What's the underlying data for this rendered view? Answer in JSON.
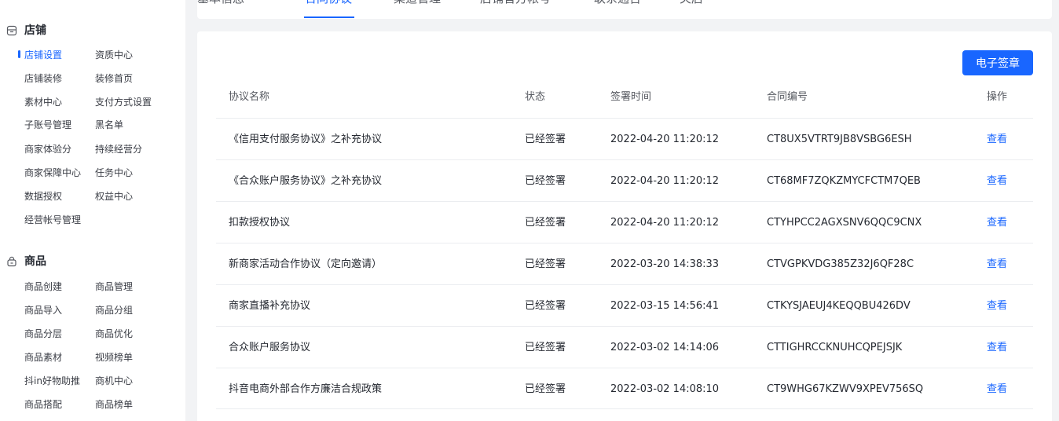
{
  "sidebar": {
    "sections": [
      {
        "title": "店铺",
        "icon": "store-icon",
        "items": [
          "店铺设置",
          "资质中心",
          "店铺装修",
          "装修首页",
          "素材中心",
          "支付方式设置",
          "子账号管理",
          "黑名单",
          "商家体验分",
          "持续经营分",
          "商家保障中心",
          "任务中心",
          "数据授权",
          "权益中心",
          "经营帐号管理"
        ],
        "active": "店铺设置"
      },
      {
        "title": "商品",
        "icon": "bag-icon",
        "items": [
          "商品创建",
          "商品管理",
          "商品导入",
          "商品分组",
          "商品分层",
          "商品优化",
          "商品素材",
          "视频榜单",
          "抖in好物助推",
          "商机中心",
          "商品搭配",
          "商品榜单"
        ]
      }
    ]
  },
  "tabs": {
    "items": [
      "基本信息",
      "合同协议",
      "渠道管理",
      "店铺官方帐号",
      "联系通告",
      "关店"
    ],
    "active": "合同协议"
  },
  "main": {
    "esign_button": "电子签章",
    "table": {
      "headers": [
        "协议名称",
        "状态",
        "签署时间",
        "合同编号",
        "操作"
      ],
      "rows": [
        {
          "name": "《信用支付服务协议》之补充协议",
          "status": "已经签署",
          "time": "2022-04-20 11:20:12",
          "no": "CT8UX5VTRT9JB8VSBG6ESH",
          "op": "查看"
        },
        {
          "name": "《合众账户服务协议》之补充协议",
          "status": "已经签署",
          "time": "2022-04-20 11:20:12",
          "no": "CT68MF7ZQKZMYCFCTM7QEB",
          "op": "查看"
        },
        {
          "name": "扣款授权协议",
          "status": "已经签署",
          "time": "2022-04-20 11:20:12",
          "no": "CTYHPCC2AGXSNV6QQC9CNX",
          "op": "查看"
        },
        {
          "name": "新商家活动合作协议（定向邀请）",
          "status": "已经签署",
          "time": "2022-03-20 14:38:33",
          "no": "CTVGPKVDG385Z32J6QF28C",
          "op": "查看"
        },
        {
          "name": "商家直播补充协议",
          "status": "已经签署",
          "time": "2022-03-15 14:56:41",
          "no": "CTKYSJAEUJ4KEQQBU426DV",
          "op": "查看"
        },
        {
          "name": "合众账户服务协议",
          "status": "已经签署",
          "time": "2022-03-02 14:14:06",
          "no": "CTTIGHRCCKNUHCQPEJSJK",
          "op": "查看"
        },
        {
          "name": "抖音电商外部合作方廉洁合规政策",
          "status": "已经签署",
          "time": "2022-03-02 14:08:10",
          "no": "CT9WHG67KZWV9XPEV756SQ",
          "op": "查看"
        }
      ]
    }
  },
  "colors": {
    "accent": "#1966ff",
    "background": "#f2f3f5",
    "text": "#252931"
  }
}
